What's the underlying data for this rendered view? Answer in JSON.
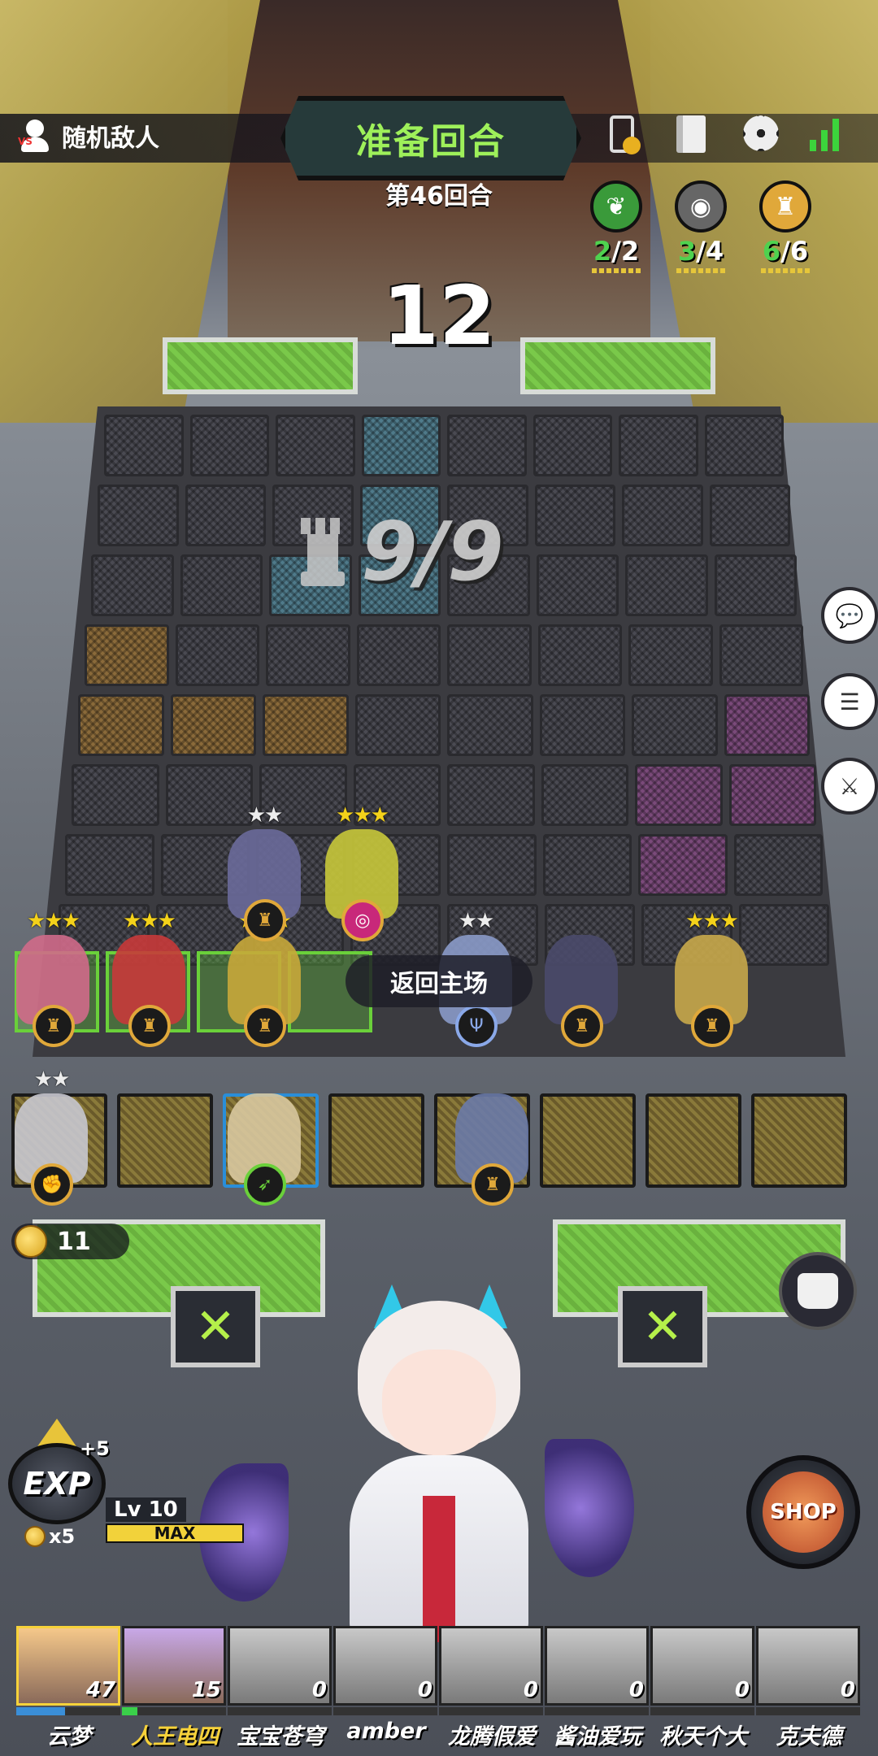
{
  "header": {
    "enemy_label": "随机敌人",
    "phase_title": "准备回合",
    "round_label": "第46回合",
    "timer": "12"
  },
  "traits": [
    {
      "icon": "leaf-icon",
      "active": "2",
      "total": "/2",
      "color": "#3a9a3a"
    },
    {
      "icon": "eye-icon",
      "active": "3",
      "total": "/4",
      "color": "#666"
    },
    {
      "icon": "crest-icon",
      "active": "6",
      "total": "/6",
      "color": "#e0a83a"
    }
  ],
  "board": {
    "units_text": "9/9",
    "return_tooltip": "返回主场"
  },
  "champions_board": [
    {
      "stars": "★★★",
      "star_color": "gold",
      "role": "crest-icon"
    },
    {
      "stars": "★★★",
      "star_color": "gold",
      "role": "crest-icon"
    },
    {
      "stars": "★★★",
      "star_color": "gold",
      "role": "crest-icon"
    },
    {
      "stars": "★★",
      "star_color": "silver",
      "role": "crest-icon"
    },
    {
      "stars": "★★★",
      "star_color": "gold",
      "role": "target-icon"
    },
    {
      "stars": "★★",
      "star_color": "silver",
      "role": "trident-icon"
    },
    {
      "stars": "",
      "star_color": "gold",
      "role": "crest-icon"
    },
    {
      "stars": "★★★",
      "star_color": "gold",
      "role": "crest-icon"
    }
  ],
  "bench": [
    {
      "stars": "★★",
      "role": "fist-icon"
    },
    {
      "stars": "",
      "role": "bow-icon"
    },
    {
      "stars": "",
      "role": "crest-icon"
    }
  ],
  "gold": "11",
  "exp": {
    "label": "EXP",
    "plus": "+5",
    "cost": "x5",
    "level": "Lv 10",
    "level_status": "MAX"
  },
  "shop_label": "SHOP",
  "players": [
    {
      "name": "云梦",
      "hp": "47",
      "hp_fraction": 0.47,
      "active": true,
      "color": true
    },
    {
      "name": "人王电四",
      "hp": "15",
      "hp_fraction": 0.15,
      "active": false,
      "color": true,
      "me": true
    },
    {
      "name": "宝宝苍穹",
      "hp": "0",
      "hp_fraction": 0,
      "active": false,
      "color": false
    },
    {
      "name": "amber",
      "hp": "0",
      "hp_fraction": 0,
      "active": false,
      "color": false
    },
    {
      "name": "龙腾假爱",
      "hp": "0",
      "hp_fraction": 0,
      "active": false,
      "color": false
    },
    {
      "name": "酱油爱玩",
      "hp": "0",
      "hp_fraction": 0,
      "active": false,
      "color": false
    },
    {
      "name": "秋天个大",
      "hp": "0",
      "hp_fraction": 0,
      "active": false,
      "color": false
    },
    {
      "name": "克夫德",
      "hp": "0",
      "hp_fraction": 0,
      "active": false,
      "color": false
    }
  ]
}
